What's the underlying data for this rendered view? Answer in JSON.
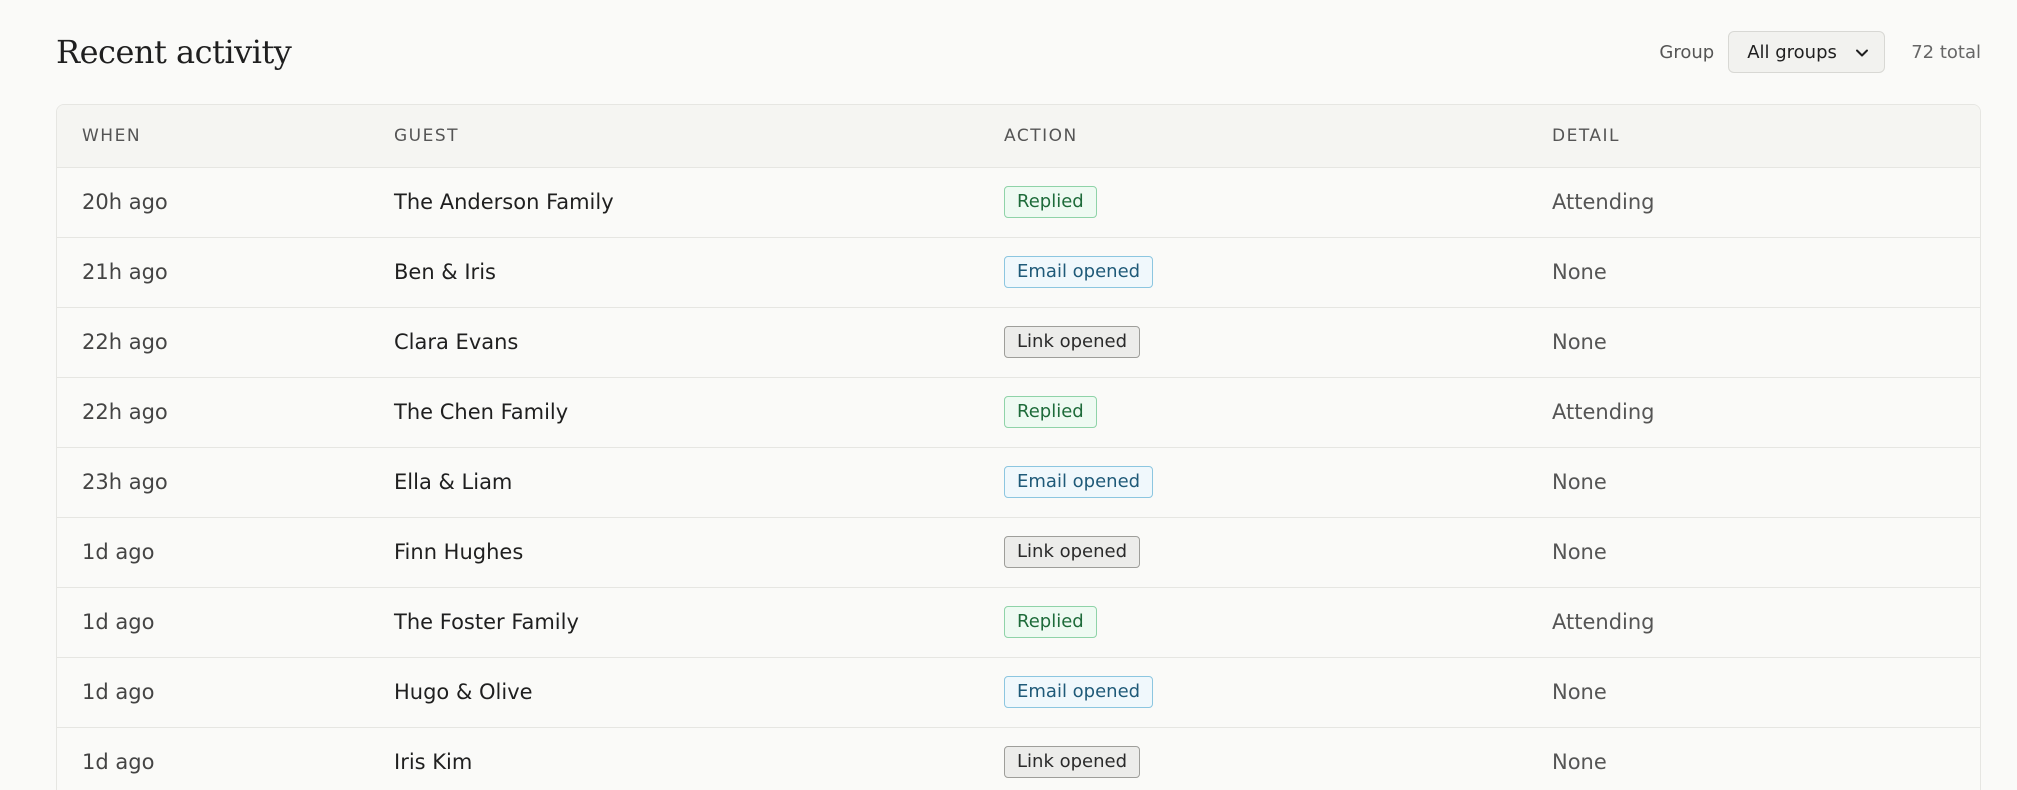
{
  "header": {
    "title": "Recent activity",
    "group_label": "Group",
    "group_select_value": "All groups",
    "total": "72 total"
  },
  "table": {
    "columns": [
      "WHEN",
      "GUEST",
      "ACTION",
      "DETAIL"
    ],
    "rows": [
      {
        "when": "20h ago",
        "guest": "The Anderson Family",
        "action": "Replied",
        "action_kind": "replied",
        "detail": "Attending"
      },
      {
        "when": "21h ago",
        "guest": "Ben & Iris",
        "action": "Email opened",
        "action_kind": "email",
        "detail": "None"
      },
      {
        "when": "22h ago",
        "guest": "Clara Evans",
        "action": "Link opened",
        "action_kind": "link",
        "detail": "None"
      },
      {
        "when": "22h ago",
        "guest": "The Chen Family",
        "action": "Replied",
        "action_kind": "replied",
        "detail": "Attending"
      },
      {
        "when": "23h ago",
        "guest": "Ella & Liam",
        "action": "Email opened",
        "action_kind": "email",
        "detail": "None"
      },
      {
        "when": "1d ago",
        "guest": "Finn Hughes",
        "action": "Link opened",
        "action_kind": "link",
        "detail": "None"
      },
      {
        "when": "1d ago",
        "guest": "The Foster Family",
        "action": "Replied",
        "action_kind": "replied",
        "detail": "Attending"
      },
      {
        "when": "1d ago",
        "guest": "Hugo & Olive",
        "action": "Email opened",
        "action_kind": "email",
        "detail": "None"
      },
      {
        "when": "1d ago",
        "guest": "Iris Kim",
        "action": "Link opened",
        "action_kind": "link",
        "detail": "None"
      }
    ]
  },
  "colors": {
    "replied": "#1e6b3a",
    "email_opened": "#1f5a78",
    "link_opened": "#2a2a2a",
    "background": "#fafaf8"
  },
  "icons": {
    "select_chevron": "chevron-down-icon"
  }
}
